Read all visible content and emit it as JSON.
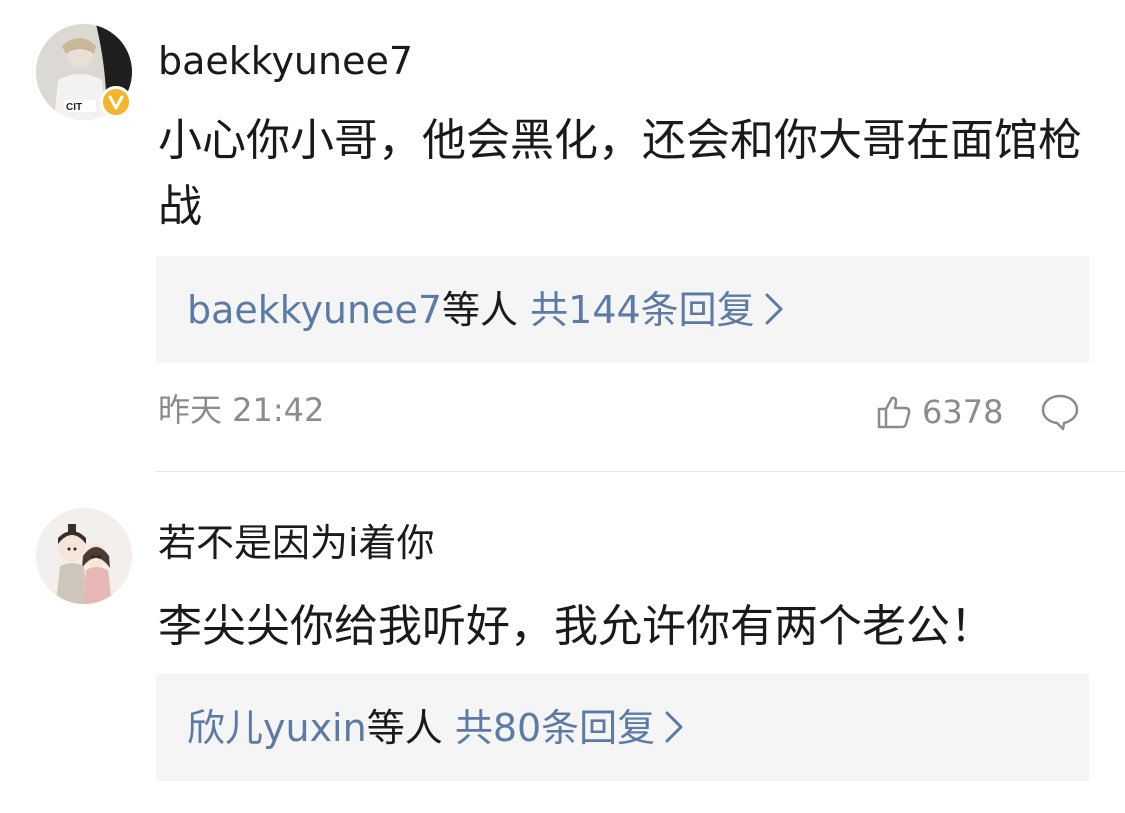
{
  "comments": [
    {
      "username": "baekkyunee7",
      "avatar_icon": "user-avatar-photo",
      "verified_badge": "V",
      "content": "小心你小哥，他会黑化，还会和你大哥在面馆枪战",
      "replies": {
        "users": "baekkyunee7",
        "suffix": "等人",
        "count": "共144条回复"
      },
      "time": "昨天 21:42",
      "likes": "6378"
    },
    {
      "username": "若不是因为i着你",
      "avatar_icon": "couple-avatar-illustration",
      "content": "李尖尖你给我听好，我允许你有两个老公！",
      "replies": {
        "users": "欣儿yuxin",
        "suffix": "等人",
        "count": "共80条回复"
      }
    }
  ],
  "colors": {
    "link": "#5b7ba6",
    "meta": "#8c8c8c",
    "reply_bg": "#f5f5f5",
    "badge": "#f2b52b"
  }
}
